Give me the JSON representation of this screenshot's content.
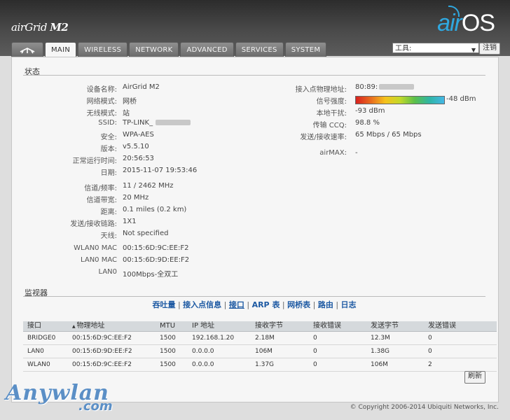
{
  "brand": {
    "air": "air",
    "grid": "Grid",
    "model": "M2"
  },
  "logo": {
    "air": "air",
    "os": "OS"
  },
  "tabs": [
    {
      "label": "",
      "icon": "ubnt-logo-icon"
    },
    {
      "label": "MAIN"
    },
    {
      "label": "WIRELESS"
    },
    {
      "label": "NETWORK"
    },
    {
      "label": "ADVANCED"
    },
    {
      "label": "SERVICES"
    },
    {
      "label": "SYSTEM"
    }
  ],
  "toolbar": {
    "tools_value": "工具:",
    "logout_label": "注销"
  },
  "status": {
    "title": "状态",
    "left": [
      {
        "label": "设备名称:",
        "value": "AirGrid M2"
      },
      {
        "label": "网络模式:",
        "value": "网桥"
      },
      {
        "label": "无线模式:",
        "value": "站"
      },
      {
        "label": "SSID:",
        "value": "TP-LINK_"
      },
      {
        "label": "安全:",
        "value": "WPA-AES"
      },
      {
        "label": "版本:",
        "value": "v5.5.10"
      },
      {
        "label": "正常运行时间:",
        "value": "20:56:53"
      },
      {
        "label": "日期:",
        "value": "2015-11-07 19:53:46"
      },
      {
        "label": "信道/频率:",
        "value": "11 / 2462 MHz"
      },
      {
        "label": "信道带宽:",
        "value": "20 MHz"
      },
      {
        "label": "距离:",
        "value": "0.1 miles (0.2 km)"
      },
      {
        "label": "发送/接收链路:",
        "value": "1X1"
      },
      {
        "label": "天线:",
        "value": "Not specified"
      },
      {
        "label": "WLAN0 MAC",
        "value": "00:15:6D:9C:EE:F2"
      },
      {
        "label": "LAN0 MAC",
        "value": "00:15:6D:9D:EE:F2"
      },
      {
        "label": "LAN0",
        "value": "100Mbps-全双工"
      }
    ],
    "right": [
      {
        "label": "接入点物理地址:",
        "value": "80:89:"
      },
      {
        "label": "信号强度:",
        "value": "-48 dBm"
      },
      {
        "label": "本地干扰:",
        "value": "-93 dBm"
      },
      {
        "label": "传输 CCQ:",
        "value": "98.8 %"
      },
      {
        "label": "发送/接收速率:",
        "value": "65 Mbps / 65 Mbps"
      },
      {
        "label": "airMAX:",
        "value": "-"
      }
    ],
    "signal_fill": 1.0
  },
  "monitor": {
    "title": "监视器",
    "links": [
      "吞吐量",
      "接入点信息",
      "接口",
      "ARP 表",
      "网桥表",
      "路由",
      "日志"
    ],
    "columns": [
      "接口",
      "物理地址",
      "MTU",
      "IP 地址",
      "接收字节",
      "接收错误",
      "发送字节",
      "发送错误"
    ],
    "rows": [
      [
        "BRIDGE0",
        "00:15:6D:9C:EE:F2",
        "1500",
        "192.168.1.20",
        "2.18M",
        "0",
        "12.3M",
        "0"
      ],
      [
        "LAN0",
        "00:15:6D:9D:EE:F2",
        "1500",
        "0.0.0.0",
        "106M",
        "0",
        "1.38G",
        "0"
      ],
      [
        "WLAN0",
        "00:15:6D:9C:EE:F2",
        "1500",
        "0.0.0.0",
        "1.37G",
        "0",
        "106M",
        "2"
      ]
    ],
    "refresh_label": "刷新"
  },
  "footer": {
    "copyright": "© Copyright 2006-2014 Ubiquiti Networks, Inc."
  },
  "watermark": {
    "text1": "Anywlan",
    "text2": ".com"
  }
}
